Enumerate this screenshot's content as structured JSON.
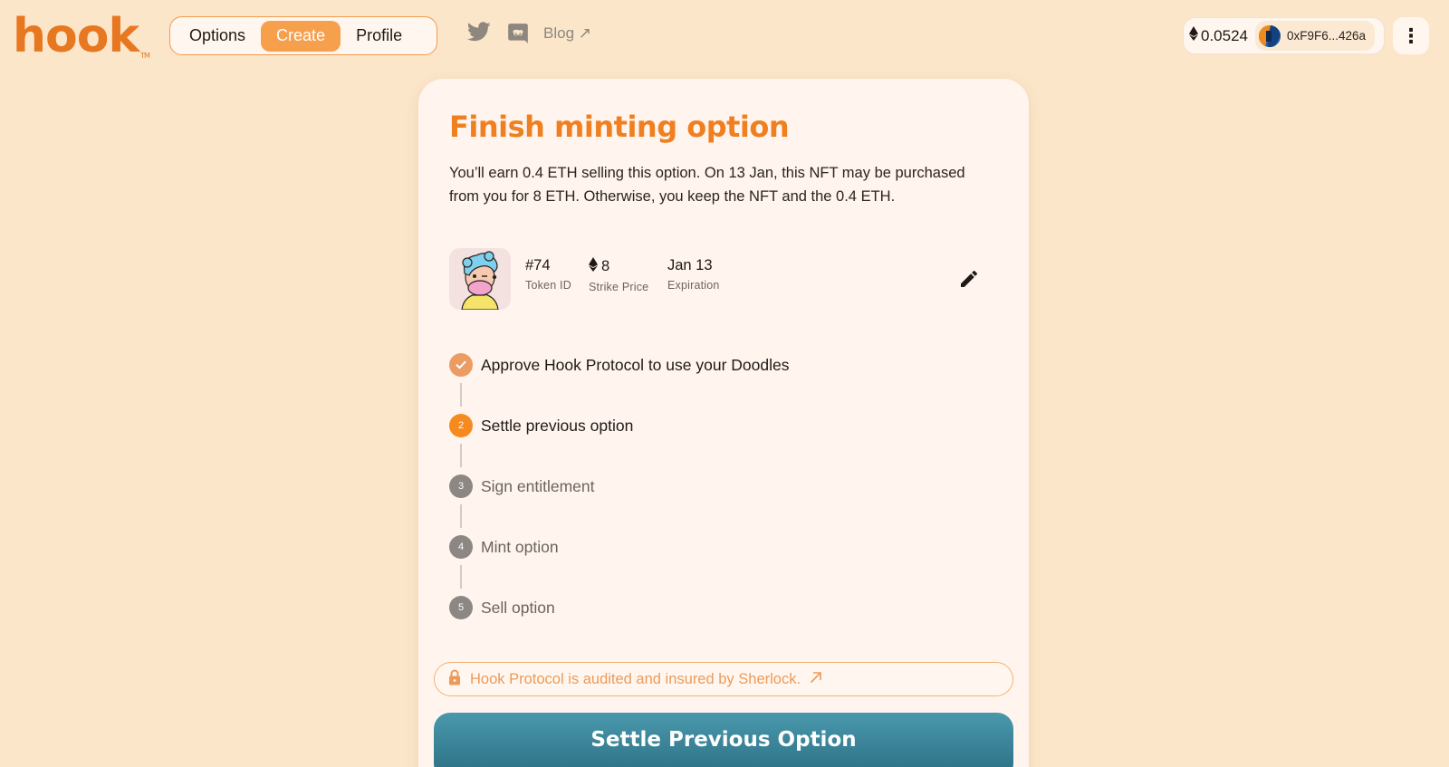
{
  "brand": {
    "logo": "hook",
    "trademark": "TM"
  },
  "nav": {
    "tabs": [
      {
        "label": "Options"
      },
      {
        "label": "Create",
        "active": true
      },
      {
        "label": "Profile"
      }
    ]
  },
  "social": {
    "blog_label": "Blog ↗"
  },
  "wallet": {
    "balance": "0.0524",
    "address": "0xF9F6...426a"
  },
  "card": {
    "title": "Finish minting option",
    "description": "You’ll earn 0.4 ETH selling this option. On 13 Jan, this NFT may be purchased from you for 8 ETH. Otherwise, you keep the NFT and the 0.4 ETH.",
    "token": {
      "id": "#74",
      "id_label": "Token ID",
      "strike": "8",
      "strike_label": "Strike Price",
      "expiration": "Jan 13",
      "expiration_label": "Expiration"
    },
    "steps": [
      {
        "number": "1",
        "label": "Approve Hook Protocol to use your Doodles",
        "status": "done"
      },
      {
        "number": "2",
        "label": "Settle previous option",
        "status": "current"
      },
      {
        "number": "3",
        "label": "Sign entitlement",
        "status": "pending"
      },
      {
        "number": "4",
        "label": "Mint option",
        "status": "pending"
      },
      {
        "number": "5",
        "label": "Sell option",
        "status": "pending"
      }
    ],
    "audit_text": "Hook Protocol is audited and insured by Sherlock.",
    "cta_label": "Settle Previous Option"
  },
  "colors": {
    "background": "#fbe6c9",
    "accent": "#f07f1f",
    "cta": "#3a8499",
    "step_done": "#ec9b63",
    "step_current": "#f68a1e",
    "step_pending": "#8c8783"
  }
}
